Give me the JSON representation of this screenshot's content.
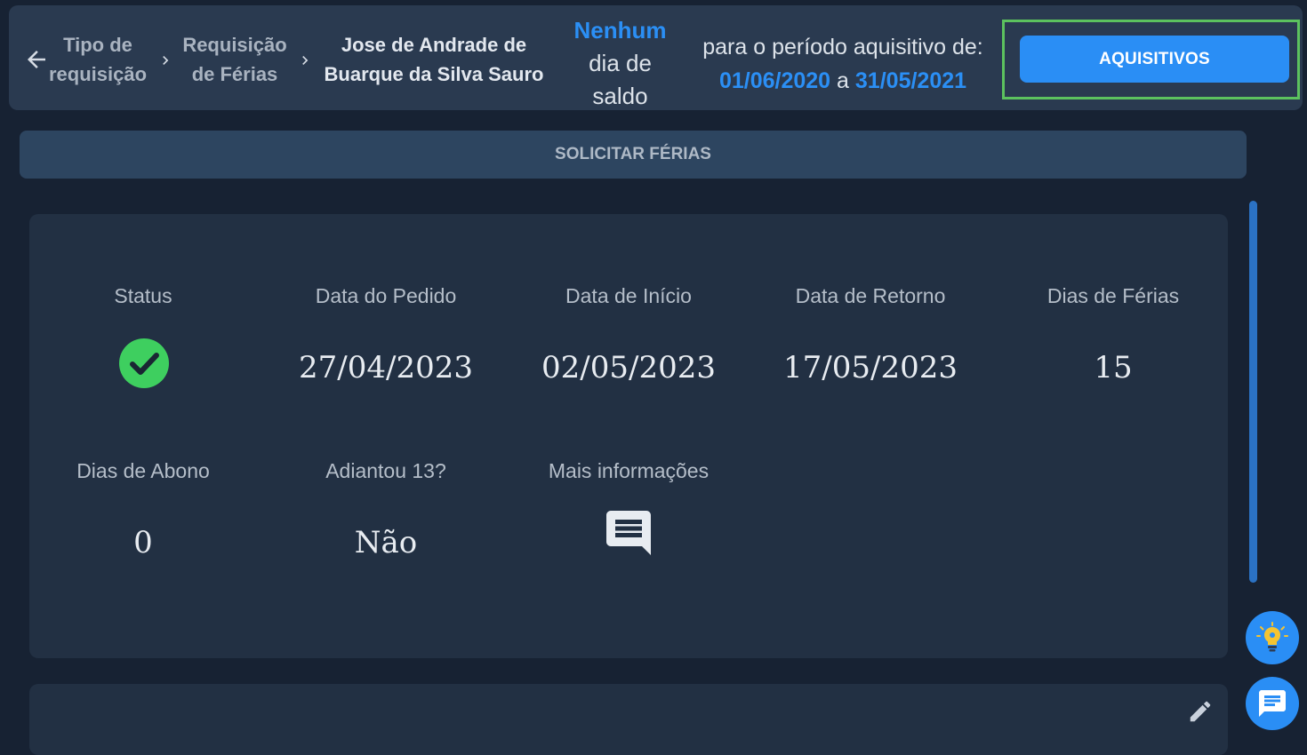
{
  "breadcrumb": {
    "items": [
      {
        "line1": "Tipo de",
        "line2": "requisição"
      },
      {
        "line1": "Requisição",
        "line2": "de Férias"
      },
      {
        "line1": "Jose de Andrade de",
        "line2": "Buarque da Silva Sauro"
      }
    ]
  },
  "saldo": {
    "highlight": "Nenhum",
    "line2": "dia de",
    "line3": "saldo"
  },
  "periodo": {
    "label": "para o período aquisitivo de:",
    "start": "01/06/2020",
    "connector": "a",
    "end": "31/05/2021"
  },
  "buttons": {
    "aquisitivos": "AQUISITIVOS",
    "solicitar": "SOLICITAR FÉRIAS"
  },
  "request": {
    "status_label": "Status",
    "data_pedido_label": "Data do Pedido",
    "data_pedido": "27/04/2023",
    "data_inicio_label": "Data de Início",
    "data_inicio": "02/05/2023",
    "data_retorno_label": "Data de Retorno",
    "data_retorno": "17/05/2023",
    "dias_ferias_label": "Dias de Férias",
    "dias_ferias": "15",
    "dias_abono_label": "Dias de Abono",
    "dias_abono": "0",
    "adiantou_label": "Adiantou 13?",
    "adiantou": "Não",
    "mais_info_label": "Mais informações"
  },
  "icons": {
    "back": "arrow-left-icon",
    "status": "check-circle-icon",
    "info": "comment-icon",
    "edit": "pencil-icon",
    "idea": "lightbulb-icon",
    "chat": "chat-icon"
  },
  "colors": {
    "accent": "#2a8ef5",
    "success": "#3ecf5f",
    "highlight_border": "#5cc25e",
    "background": "#172233",
    "card": "#223043"
  }
}
